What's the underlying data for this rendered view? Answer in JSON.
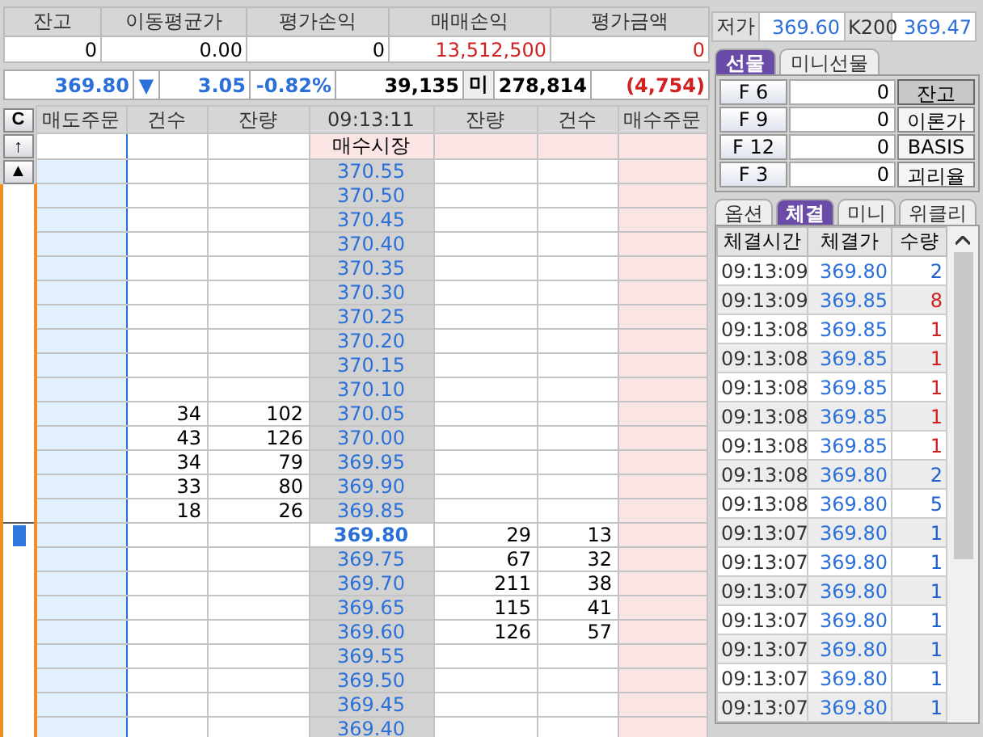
{
  "summary": {
    "columns": [
      "잔고",
      "이동평균가",
      "평가손익",
      "매매손익",
      "평가금액"
    ],
    "values": [
      {
        "text": "0",
        "color": "#000000"
      },
      {
        "text": "0.00",
        "color": "#000000"
      },
      {
        "text": "0",
        "color": "#000000"
      },
      {
        "text": "13,512,500",
        "color": "#d02020"
      },
      {
        "text": "0",
        "color": "#d02020"
      }
    ]
  },
  "quote_bar": {
    "price": "369.80",
    "direction": "▼",
    "change": "3.05",
    "rate": "-0.82%",
    "volume": "39,135",
    "oi_label": "미",
    "open_interest": "278,814",
    "oi_change": "(4,754)"
  },
  "order_book": {
    "columns": [
      "매도주문",
      "건수",
      "잔량",
      "09:13:11",
      "잔량",
      "건수",
      "매수주문"
    ],
    "side_buttons": [
      "C",
      "↑",
      "▲"
    ],
    "rows": [
      {
        "price": "매수시장",
        "kind": "label"
      },
      {
        "price": "370.55",
        "kind": "ask"
      },
      {
        "price": "370.50",
        "kind": "ask"
      },
      {
        "price": "370.45",
        "kind": "ask"
      },
      {
        "price": "370.40",
        "kind": "ask"
      },
      {
        "price": "370.35",
        "kind": "ask"
      },
      {
        "price": "370.30",
        "kind": "ask"
      },
      {
        "price": "370.25",
        "kind": "ask"
      },
      {
        "price": "370.20",
        "kind": "ask"
      },
      {
        "price": "370.15",
        "kind": "ask"
      },
      {
        "price": "370.10",
        "kind": "ask"
      },
      {
        "price": "370.05",
        "kind": "ask",
        "sell_count": "34",
        "sell_qty": "102"
      },
      {
        "price": "370.00",
        "kind": "ask",
        "sell_count": "43",
        "sell_qty": "126"
      },
      {
        "price": "369.95",
        "kind": "ask",
        "sell_count": "34",
        "sell_qty": "79"
      },
      {
        "price": "369.90",
        "kind": "ask",
        "sell_count": "33",
        "sell_qty": "80"
      },
      {
        "price": "369.85",
        "kind": "ask",
        "sell_count": "18",
        "sell_qty": "26"
      },
      {
        "price": "369.80",
        "kind": "current",
        "buy_qty": "29",
        "buy_count": "13"
      },
      {
        "price": "369.75",
        "kind": "bid",
        "buy_qty": "67",
        "buy_count": "32"
      },
      {
        "price": "369.70",
        "kind": "bid",
        "buy_qty": "211",
        "buy_count": "38"
      },
      {
        "price": "369.65",
        "kind": "bid",
        "buy_qty": "115",
        "buy_count": "41"
      },
      {
        "price": "369.60",
        "kind": "bid",
        "buy_qty": "126",
        "buy_count": "57"
      },
      {
        "price": "369.55",
        "kind": "bid"
      },
      {
        "price": "369.50",
        "kind": "bid"
      },
      {
        "price": "369.45",
        "kind": "bid"
      },
      {
        "price": "369.40",
        "kind": "bid"
      }
    ]
  },
  "price_info": [
    {
      "label": "저가",
      "value": "369.60"
    },
    {
      "label": "K200",
      "value": "369.47"
    }
  ],
  "futures_tabs": [
    {
      "label": "선물",
      "selected": true
    },
    {
      "label": "미니선물",
      "selected": false
    }
  ],
  "futures_rows": [
    {
      "label": "F 6",
      "value": "0",
      "action": "잔고",
      "action_selected": true
    },
    {
      "label": "F 9",
      "value": "0",
      "action": "이론가",
      "action_selected": false
    },
    {
      "label": "F 12",
      "value": "0",
      "action": "BASIS",
      "action_selected": false
    },
    {
      "label": "F 3",
      "value": "0",
      "action": "괴리율",
      "action_selected": false
    }
  ],
  "trade_tabs": [
    {
      "label": "옵션",
      "selected": false
    },
    {
      "label": "체결",
      "selected": true
    },
    {
      "label": "미니",
      "selected": false
    },
    {
      "label": "위클리",
      "selected": false
    }
  ],
  "trades": {
    "columns": [
      "체결시간",
      "체결가",
      "수량"
    ],
    "rows": [
      {
        "time": "09:13:09",
        "price": "369.80",
        "qty": "2",
        "color": "#2060d0"
      },
      {
        "time": "09:13:09",
        "price": "369.85",
        "qty": "8",
        "color": "#d02020"
      },
      {
        "time": "09:13:08",
        "price": "369.85",
        "qty": "1",
        "color": "#d02020"
      },
      {
        "time": "09:13:08",
        "price": "369.85",
        "qty": "1",
        "color": "#d02020"
      },
      {
        "time": "09:13:08",
        "price": "369.85",
        "qty": "1",
        "color": "#d02020"
      },
      {
        "time": "09:13:08",
        "price": "369.85",
        "qty": "1",
        "color": "#d02020"
      },
      {
        "time": "09:13:08",
        "price": "369.85",
        "qty": "1",
        "color": "#d02020"
      },
      {
        "time": "09:13:08",
        "price": "369.80",
        "qty": "2",
        "color": "#2060d0"
      },
      {
        "time": "09:13:08",
        "price": "369.80",
        "qty": "5",
        "color": "#2060d0"
      },
      {
        "time": "09:13:07",
        "price": "369.80",
        "qty": "1",
        "color": "#2060d0"
      },
      {
        "time": "09:13:07",
        "price": "369.80",
        "qty": "1",
        "color": "#2060d0"
      },
      {
        "time": "09:13:07",
        "price": "369.80",
        "qty": "1",
        "color": "#2060d0"
      },
      {
        "time": "09:13:07",
        "price": "369.80",
        "qty": "1",
        "color": "#2060d0"
      },
      {
        "time": "09:13:07",
        "price": "369.80",
        "qty": "1",
        "color": "#2060d0"
      },
      {
        "time": "09:13:07",
        "price": "369.80",
        "qty": "1",
        "color": "#2060d0"
      },
      {
        "time": "09:13:07",
        "price": "369.80",
        "qty": "1",
        "color": "#2060d0"
      }
    ]
  }
}
